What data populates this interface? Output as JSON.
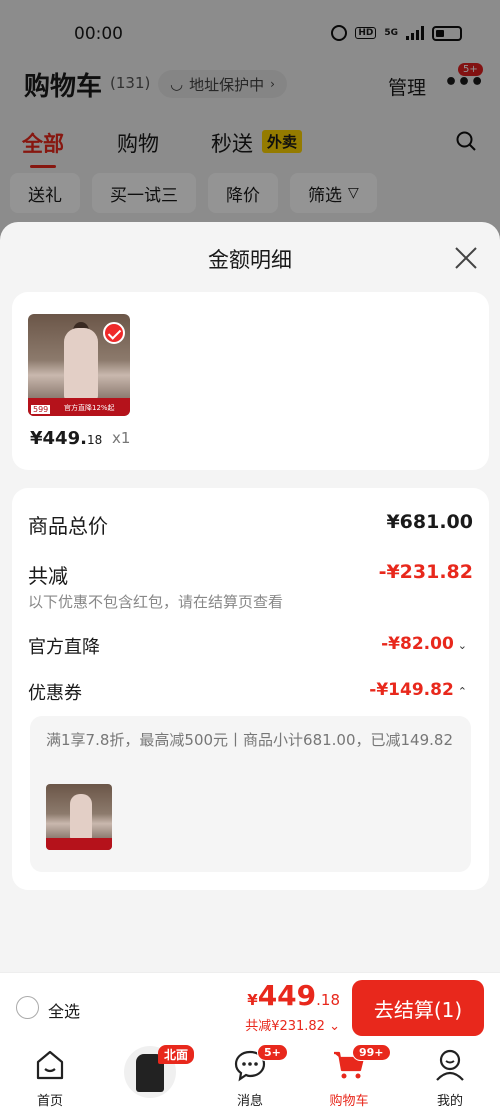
{
  "status_bar": {
    "time": "00:00",
    "hd": "HD",
    "network": "5G"
  },
  "header": {
    "title": "购物车",
    "count": "(131)",
    "address": "地址保护中",
    "manage": "管理",
    "more": "•••",
    "more_badge": "5+"
  },
  "tabs": [
    {
      "label": "全部"
    },
    {
      "label": "购物"
    },
    {
      "label": "秒送"
    }
  ],
  "tab_tag": "外卖",
  "chips": [
    "送礼",
    "买一试三",
    "降价",
    "筛选"
  ],
  "sheet": {
    "title": "金额明细",
    "item": {
      "price_int": "¥449.",
      "price_dec": "18",
      "qty": "x1",
      "thumb_price": "599",
      "thumb_banner": "官方直降12%起"
    },
    "rows": {
      "total_label": "商品总价",
      "total_value": "¥681.00",
      "reduce_label": "共减",
      "reduce_value": "-¥231.82",
      "reduce_note": "以下优惠不包含红包，请在结算页查看",
      "official_label": "官方直降",
      "official_value": "-¥82.00",
      "coupon_label": "优惠券",
      "coupon_value": "-¥149.82",
      "coupon_detail": "满1享7.8折，最高减500元丨商品小计681.00，已减149.82"
    }
  },
  "checkout": {
    "select_all": "全选",
    "total_yen": "¥",
    "total_int": "449",
    "total_dec": ".18",
    "saved": "共减¥231.82",
    "pay_button": "去结算(1)"
  },
  "tabbar": [
    {
      "label": "首页"
    },
    {
      "label": "消息",
      "badge": "5+"
    },
    {
      "label": "购物车",
      "badge": "99+"
    },
    {
      "label": "我的"
    }
  ],
  "ad_tag": "北面",
  "colors": {
    "accent": "#e8281c",
    "sheet_bg": "#f4f4f4"
  }
}
